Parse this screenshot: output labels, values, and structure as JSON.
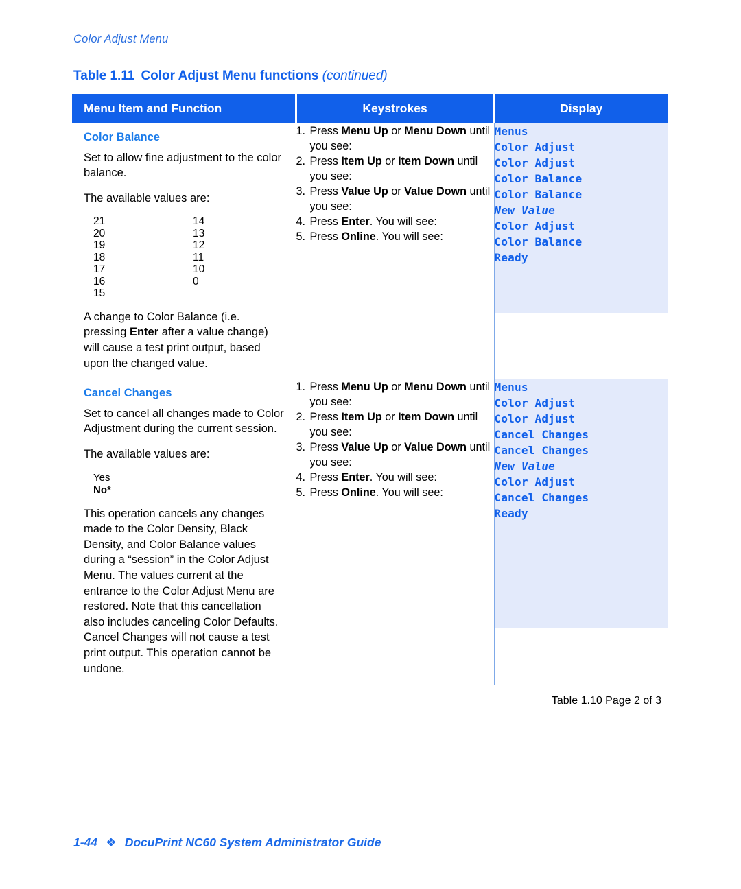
{
  "running_head": "Color Adjust Menu",
  "colors": {
    "header_blue": "#1160ea",
    "display_bg": "#e3eafb",
    "display_text": "#1160ea",
    "caption_blue": "#1160ea",
    "rule_blue": "#7fa9e8"
  },
  "caption": {
    "number": "Table 1.11",
    "title": "Color Adjust Menu functions",
    "continued": "(continued)"
  },
  "table": {
    "headers": {
      "col1": "Menu Item and Function",
      "col2": "Keystrokes",
      "col3": "Display"
    },
    "rows": [
      {
        "title": "Color Balance",
        "paragraphs": [
          "Set to allow fine adjustment to the color balance.",
          "The available values are:"
        ],
        "values_left": [
          "21",
          "20",
          "19",
          "18",
          "17",
          "16",
          "15"
        ],
        "values_right": [
          "14",
          "13",
          "12",
          "11",
          "10",
          "0",
          ""
        ],
        "note_parts": [
          {
            "text": "A change to Color Balance (i.e. pressing ",
            "bold": false
          },
          {
            "text": "Enter",
            "bold": true
          },
          {
            "text": " after a value change) will cause a test print output, based upon the changed value.",
            "bold": false
          }
        ],
        "steps": [
          {
            "num": "1.",
            "parts": [
              {
                "text": "Press ",
                "bold": false
              },
              {
                "text": "Menu Up",
                "bold": true
              },
              {
                "text": " or ",
                "bold": false
              },
              {
                "text": "Menu Down",
                "bold": true
              },
              {
                "text": " until you see:",
                "bold": false
              }
            ],
            "display": [
              "Menus",
              "Color Adjust"
            ],
            "display_italic": [
              false,
              false
            ]
          },
          {
            "num": "2.",
            "parts": [
              {
                "text": "Press ",
                "bold": false
              },
              {
                "text": "Item Up",
                "bold": true
              },
              {
                "text": " or ",
                "bold": false
              },
              {
                "text": "Item Down",
                "bold": true
              },
              {
                "text": " until you see:",
                "bold": false
              }
            ],
            "display": [
              "Color Adjust",
              "Color Balance"
            ],
            "display_italic": [
              false,
              false
            ]
          },
          {
            "num": "3.",
            "parts": [
              {
                "text": "Press ",
                "bold": false
              },
              {
                "text": "Value Up",
                "bold": true
              },
              {
                "text": " or ",
                "bold": false
              },
              {
                "text": "Value Down",
                "bold": true
              },
              {
                "text": " until you see:",
                "bold": false
              }
            ],
            "display": [
              "Color Balance",
              "New Value"
            ],
            "display_italic": [
              false,
              true
            ]
          },
          {
            "num": "4.",
            "parts": [
              {
                "text": "Press ",
                "bold": false
              },
              {
                "text": "Enter",
                "bold": true
              },
              {
                "text": ". You will see:",
                "bold": false
              }
            ],
            "display": [
              "Color Adjust",
              "Color Balance"
            ],
            "display_italic": [
              false,
              false
            ]
          },
          {
            "num": "5.",
            "parts": [
              {
                "text": "Press ",
                "bold": false
              },
              {
                "text": "Online",
                "bold": true
              },
              {
                "text": ". You will see:",
                "bold": false
              }
            ],
            "display": [
              "Ready"
            ],
            "display_italic": [
              false
            ]
          }
        ]
      },
      {
        "title": "Cancel Changes",
        "paragraphs": [
          "Set to cancel all changes made to Color Adjustment during the current session.",
          "The available values are:"
        ],
        "value_options": [
          {
            "label": "Yes",
            "bold": false
          },
          {
            "label": "No*",
            "bold": true
          }
        ],
        "note_parts": [
          {
            "text": "This operation cancels any changes made to the Color Density, Black Density, and Color Balance values during a “session” in the Color Adjust Menu. The values current at the entrance to the Color Adjust Menu are restored. Note that this cancellation also includes canceling Color Defaults. Cancel Changes will not cause a test print output. This operation cannot be undone.",
            "bold": false
          }
        ],
        "steps": [
          {
            "num": "1.",
            "parts": [
              {
                "text": "Press ",
                "bold": false
              },
              {
                "text": "Menu Up",
                "bold": true
              },
              {
                "text": " or ",
                "bold": false
              },
              {
                "text": "Menu Down",
                "bold": true
              },
              {
                "text": " until you see:",
                "bold": false
              }
            ],
            "display": [
              "Menus",
              "Color Adjust"
            ],
            "display_italic": [
              false,
              false
            ]
          },
          {
            "num": "2.",
            "parts": [
              {
                "text": "Press ",
                "bold": false
              },
              {
                "text": "Item Up",
                "bold": true
              },
              {
                "text": " or ",
                "bold": false
              },
              {
                "text": "Item Down",
                "bold": true
              },
              {
                "text": " until you see:",
                "bold": false
              }
            ],
            "display": [
              "Color Adjust",
              "Cancel Changes"
            ],
            "display_italic": [
              false,
              false
            ]
          },
          {
            "num": "3.",
            "parts": [
              {
                "text": "Press ",
                "bold": false
              },
              {
                "text": "Value Up",
                "bold": true
              },
              {
                "text": " or ",
                "bold": false
              },
              {
                "text": "Value Down",
                "bold": true
              },
              {
                "text": " until you see:",
                "bold": false
              }
            ],
            "display": [
              "Cancel Changes",
              "New Value"
            ],
            "display_italic": [
              false,
              true
            ]
          },
          {
            "num": "4.",
            "parts": [
              {
                "text": "Press ",
                "bold": false
              },
              {
                "text": "Enter",
                "bold": true
              },
              {
                "text": ". You will see:",
                "bold": false
              }
            ],
            "display": [
              "Color Adjust",
              "Cancel Changes"
            ],
            "display_italic": [
              false,
              false
            ]
          },
          {
            "num": "5.",
            "parts": [
              {
                "text": "Press ",
                "bold": false
              },
              {
                "text": "Online",
                "bold": true
              },
              {
                "text": ". You will see:",
                "bold": false
              }
            ],
            "display": [
              "Ready"
            ],
            "display_italic": [
              false
            ]
          }
        ]
      }
    ],
    "footer_note": "Table 1.10  Page 2 of 3"
  },
  "page_footer": {
    "page_number": "1-44",
    "diamond": "❖",
    "title": "DocuPrint NC60 System Administrator Guide"
  }
}
